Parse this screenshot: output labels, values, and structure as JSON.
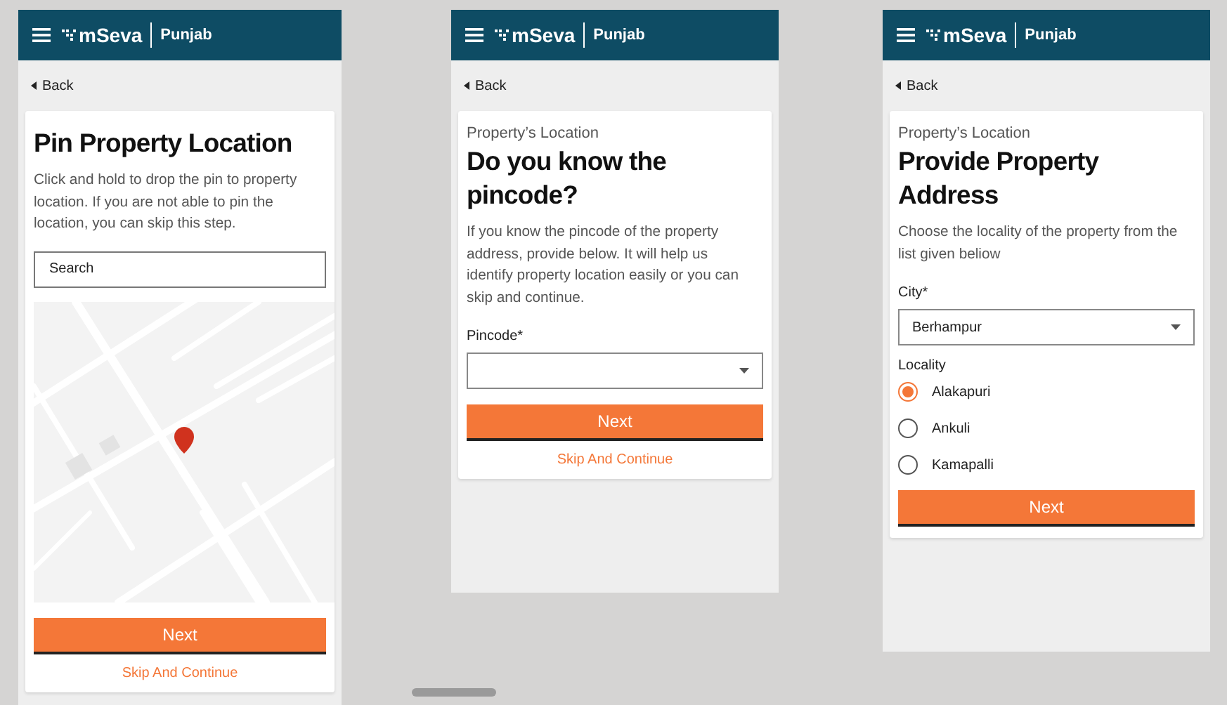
{
  "screens": [
    {
      "kind": "map",
      "header": {
        "brand": "mSeva",
        "state": "Punjab"
      },
      "back": "Back",
      "title": "Pin Property Location",
      "description": "Click and hold to drop the pin to property location. If you are not able to pin the location, you can skip this step.",
      "search": {
        "placeholder": "Search"
      },
      "next": "Next",
      "skip": "Skip And Continue"
    },
    {
      "kind": "pincode",
      "header": {
        "brand": "mSeva",
        "state": "Punjab"
      },
      "back": "Back",
      "eyebrow": "Property’s Location",
      "title": "Do you know the pincode?",
      "description": "If you know the pincode of the property address, provide below. It will help us identify property location easily or you can skip and continue.",
      "field": {
        "label": "Pincode*"
      },
      "next": "Next",
      "skip": "Skip And Continue"
    },
    {
      "kind": "address",
      "header": {
        "brand": "mSeva",
        "state": "Punjab"
      },
      "back": "Back",
      "eyebrow": "Property’s Location",
      "title": "Provide Property Address",
      "description": "Choose the locality of the property from the list given beliow",
      "field": {
        "label": "City*",
        "value": "Berhampur"
      },
      "radio_label": "Locality",
      "options": [
        {
          "label": "Alakapuri",
          "selected": true
        },
        {
          "label": "Ankuli",
          "selected": false
        },
        {
          "label": "Kamapalli",
          "selected": false
        }
      ],
      "next": "Next"
    }
  ]
}
